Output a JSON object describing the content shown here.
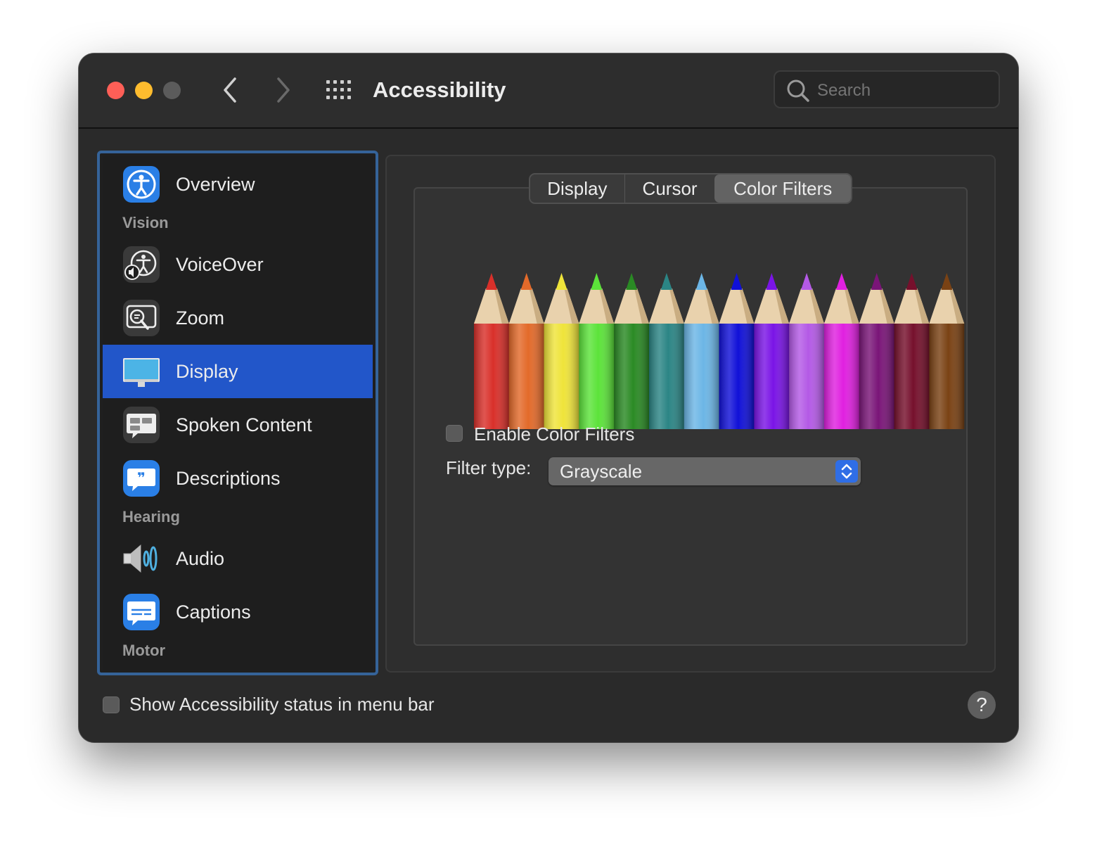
{
  "window": {
    "title": "Accessibility",
    "search_placeholder": "Search"
  },
  "sidebar": {
    "items": [
      {
        "label": "Overview",
        "icon": "accessibility-icon"
      },
      {
        "section": "Vision"
      },
      {
        "label": "VoiceOver",
        "icon": "voiceover-icon"
      },
      {
        "label": "Zoom",
        "icon": "zoom-icon"
      },
      {
        "label": "Display",
        "icon": "display-icon",
        "selected": true
      },
      {
        "label": "Spoken Content",
        "icon": "spoken-content-icon"
      },
      {
        "label": "Descriptions",
        "icon": "descriptions-icon"
      },
      {
        "section": "Hearing"
      },
      {
        "label": "Audio",
        "icon": "audio-icon"
      },
      {
        "label": "Captions",
        "icon": "captions-icon"
      },
      {
        "section": "Motor"
      }
    ]
  },
  "tabs": [
    {
      "label": "Display",
      "selected": false
    },
    {
      "label": "Cursor",
      "selected": false
    },
    {
      "label": "Color Filters",
      "selected": true
    }
  ],
  "color_filters": {
    "enable_label": "Enable Color Filters",
    "enabled": false,
    "filter_type_label": "Filter type:",
    "filter_type_value": "Grayscale",
    "pencil_colors": [
      "#d9302a",
      "#e36a2a",
      "#efe43a",
      "#5ce33a",
      "#2a8a24",
      "#2b8585",
      "#6cb6e6",
      "#1010d8",
      "#7a14e6",
      "#b45ae6",
      "#e020e0",
      "#7a1578",
      "#76102c",
      "#7a4214"
    ]
  },
  "footer": {
    "status_label": "Show Accessibility status in menu bar",
    "status_checked": false,
    "help_label": "?"
  },
  "colors": {
    "accent": "#2256c9",
    "window_bg": "#2a2a2a"
  }
}
